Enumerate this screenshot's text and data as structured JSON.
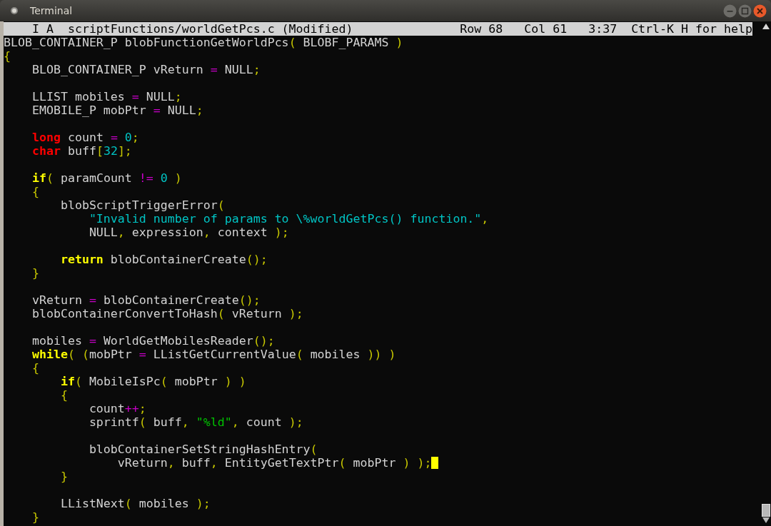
{
  "window": {
    "title": "Terminal"
  },
  "status_bar": {
    "file": "I A  scriptFunctions/worldGetPcs.c (Modified)",
    "row": "Row 68",
    "col": "Col 61",
    "time": "3:37",
    "help": "Ctrl-K H for help"
  },
  "lines": [
    {
      "kind": "code",
      "tokens": [
        {
          "kind": "plain",
          "text": "BLOB_CONTAINER_P blobFunctionGetWorldPcs"
        },
        {
          "kind": "punct",
          "text": "("
        },
        {
          "kind": "plain",
          "text": " BLOBF_PARAMS "
        },
        {
          "kind": "punct",
          "text": ")"
        }
      ]
    },
    {
      "kind": "code",
      "tokens": [
        {
          "kind": "punct",
          "text": "{"
        }
      ]
    },
    {
      "kind": "code",
      "tokens": [
        {
          "kind": "plain",
          "text": "    BLOB_CONTAINER_P vReturn "
        },
        {
          "kind": "op",
          "text": "="
        },
        {
          "kind": "plain",
          "text": " NULL"
        },
        {
          "kind": "punct",
          "text": ";"
        }
      ]
    },
    {
      "kind": "blank"
    },
    {
      "kind": "code",
      "tokens": [
        {
          "kind": "plain",
          "text": "    LLIST mobiles "
        },
        {
          "kind": "op",
          "text": "="
        },
        {
          "kind": "plain",
          "text": " NULL"
        },
        {
          "kind": "punct",
          "text": ";"
        }
      ]
    },
    {
      "kind": "code",
      "tokens": [
        {
          "kind": "plain",
          "text": "    EMOBILE_P mobPtr "
        },
        {
          "kind": "op",
          "text": "="
        },
        {
          "kind": "plain",
          "text": " NULL"
        },
        {
          "kind": "punct",
          "text": ";"
        }
      ]
    },
    {
      "kind": "blank"
    },
    {
      "kind": "code",
      "tokens": [
        {
          "kind": "type",
          "text": "    long"
        },
        {
          "kind": "plain",
          "text": " count "
        },
        {
          "kind": "op",
          "text": "="
        },
        {
          "kind": "num",
          "text": " 0"
        },
        {
          "kind": "punct",
          "text": ";"
        }
      ]
    },
    {
      "kind": "code",
      "tokens": [
        {
          "kind": "type",
          "text": "    char"
        },
        {
          "kind": "plain",
          "text": " buff"
        },
        {
          "kind": "punct",
          "text": "["
        },
        {
          "kind": "num",
          "text": "32"
        },
        {
          "kind": "punct",
          "text": "];"
        }
      ]
    },
    {
      "kind": "blank"
    },
    {
      "kind": "code",
      "tokens": [
        {
          "kind": "kw",
          "text": "    if"
        },
        {
          "kind": "punct",
          "text": "("
        },
        {
          "kind": "plain",
          "text": " paramCount "
        },
        {
          "kind": "op",
          "text": "!="
        },
        {
          "kind": "num",
          "text": " 0"
        },
        {
          "kind": "punct",
          "text": " )"
        }
      ]
    },
    {
      "kind": "code",
      "tokens": [
        {
          "kind": "punct",
          "text": "    {"
        }
      ]
    },
    {
      "kind": "code",
      "tokens": [
        {
          "kind": "plain",
          "text": "        blobScriptTriggerError"
        },
        {
          "kind": "punct",
          "text": "("
        }
      ]
    },
    {
      "kind": "code",
      "tokens": [
        {
          "kind": "str",
          "text": "            \"Invalid number of params to \\%worldGetPcs() function.\""
        },
        {
          "kind": "punct",
          "text": ","
        }
      ]
    },
    {
      "kind": "code",
      "tokens": [
        {
          "kind": "plain",
          "text": "            NULL"
        },
        {
          "kind": "punct",
          "text": ","
        },
        {
          "kind": "plain",
          "text": " expression"
        },
        {
          "kind": "punct",
          "text": ","
        },
        {
          "kind": "plain",
          "text": " context "
        },
        {
          "kind": "punct",
          "text": ");"
        }
      ]
    },
    {
      "kind": "blank"
    },
    {
      "kind": "code",
      "tokens": [
        {
          "kind": "kw",
          "text": "        return"
        },
        {
          "kind": "plain",
          "text": " blobContainerCreate"
        },
        {
          "kind": "punct",
          "text": "();"
        }
      ]
    },
    {
      "kind": "code",
      "tokens": [
        {
          "kind": "punct",
          "text": "    }"
        }
      ]
    },
    {
      "kind": "blank"
    },
    {
      "kind": "code",
      "tokens": [
        {
          "kind": "plain",
          "text": "    vReturn "
        },
        {
          "kind": "op",
          "text": "="
        },
        {
          "kind": "plain",
          "text": " blobContainerCreate"
        },
        {
          "kind": "punct",
          "text": "();"
        }
      ]
    },
    {
      "kind": "code",
      "tokens": [
        {
          "kind": "plain",
          "text": "    blobContainerConvertToHash"
        },
        {
          "kind": "punct",
          "text": "("
        },
        {
          "kind": "plain",
          "text": " vReturn "
        },
        {
          "kind": "punct",
          "text": ");"
        }
      ]
    },
    {
      "kind": "blank"
    },
    {
      "kind": "code",
      "tokens": [
        {
          "kind": "plain",
          "text": "    mobiles "
        },
        {
          "kind": "op",
          "text": "="
        },
        {
          "kind": "plain",
          "text": " WorldGetMobilesReader"
        },
        {
          "kind": "punct",
          "text": "();"
        }
      ]
    },
    {
      "kind": "code",
      "tokens": [
        {
          "kind": "kw",
          "text": "    while"
        },
        {
          "kind": "punct",
          "text": "( ("
        },
        {
          "kind": "plain",
          "text": "mobPtr "
        },
        {
          "kind": "op",
          "text": "="
        },
        {
          "kind": "plain",
          "text": " LListGetCurrentValue"
        },
        {
          "kind": "punct",
          "text": "("
        },
        {
          "kind": "plain",
          "text": " mobiles "
        },
        {
          "kind": "punct",
          "text": ")) )"
        }
      ]
    },
    {
      "kind": "code",
      "tokens": [
        {
          "kind": "punct",
          "text": "    {"
        }
      ]
    },
    {
      "kind": "code",
      "tokens": [
        {
          "kind": "kw",
          "text": "        if"
        },
        {
          "kind": "punct",
          "text": "("
        },
        {
          "kind": "plain",
          "text": " MobileIsPc"
        },
        {
          "kind": "punct",
          "text": "("
        },
        {
          "kind": "plain",
          "text": " mobPtr "
        },
        {
          "kind": "punct",
          "text": ") )"
        }
      ]
    },
    {
      "kind": "code",
      "tokens": [
        {
          "kind": "punct",
          "text": "        {"
        }
      ]
    },
    {
      "kind": "code",
      "tokens": [
        {
          "kind": "plain",
          "text": "            count"
        },
        {
          "kind": "op",
          "text": "++"
        },
        {
          "kind": "punct",
          "text": ";"
        }
      ]
    },
    {
      "kind": "code",
      "tokens": [
        {
          "kind": "plain",
          "text": "            sprintf"
        },
        {
          "kind": "punct",
          "text": "("
        },
        {
          "kind": "plain",
          "text": " buff"
        },
        {
          "kind": "punct",
          "text": ","
        },
        {
          "kind": "fmt",
          "text": " \"%ld\""
        },
        {
          "kind": "punct",
          "text": ","
        },
        {
          "kind": "plain",
          "text": " count "
        },
        {
          "kind": "punct",
          "text": ");"
        }
      ]
    },
    {
      "kind": "blank"
    },
    {
      "kind": "code",
      "tokens": [
        {
          "kind": "plain",
          "text": "            blobContainerSetStringHashEntry"
        },
        {
          "kind": "punct",
          "text": "("
        }
      ]
    },
    {
      "kind": "code",
      "cursor": true,
      "tokens": [
        {
          "kind": "plain",
          "text": "                vReturn"
        },
        {
          "kind": "punct",
          "text": ","
        },
        {
          "kind": "plain",
          "text": " buff"
        },
        {
          "kind": "punct",
          "text": ","
        },
        {
          "kind": "plain",
          "text": " EntityGetTextPtr"
        },
        {
          "kind": "punct",
          "text": "("
        },
        {
          "kind": "plain",
          "text": " mobPtr "
        },
        {
          "kind": "punct",
          "text": ") );"
        }
      ]
    },
    {
      "kind": "code",
      "tokens": [
        {
          "kind": "punct",
          "text": "        }"
        }
      ]
    },
    {
      "kind": "blank"
    },
    {
      "kind": "code",
      "tokens": [
        {
          "kind": "plain",
          "text": "        LListNext"
        },
        {
          "kind": "punct",
          "text": "("
        },
        {
          "kind": "plain",
          "text": " mobiles "
        },
        {
          "kind": "punct",
          "text": ");"
        }
      ]
    },
    {
      "kind": "code",
      "tokens": [
        {
          "kind": "punct",
          "text": "    }"
        }
      ]
    }
  ]
}
